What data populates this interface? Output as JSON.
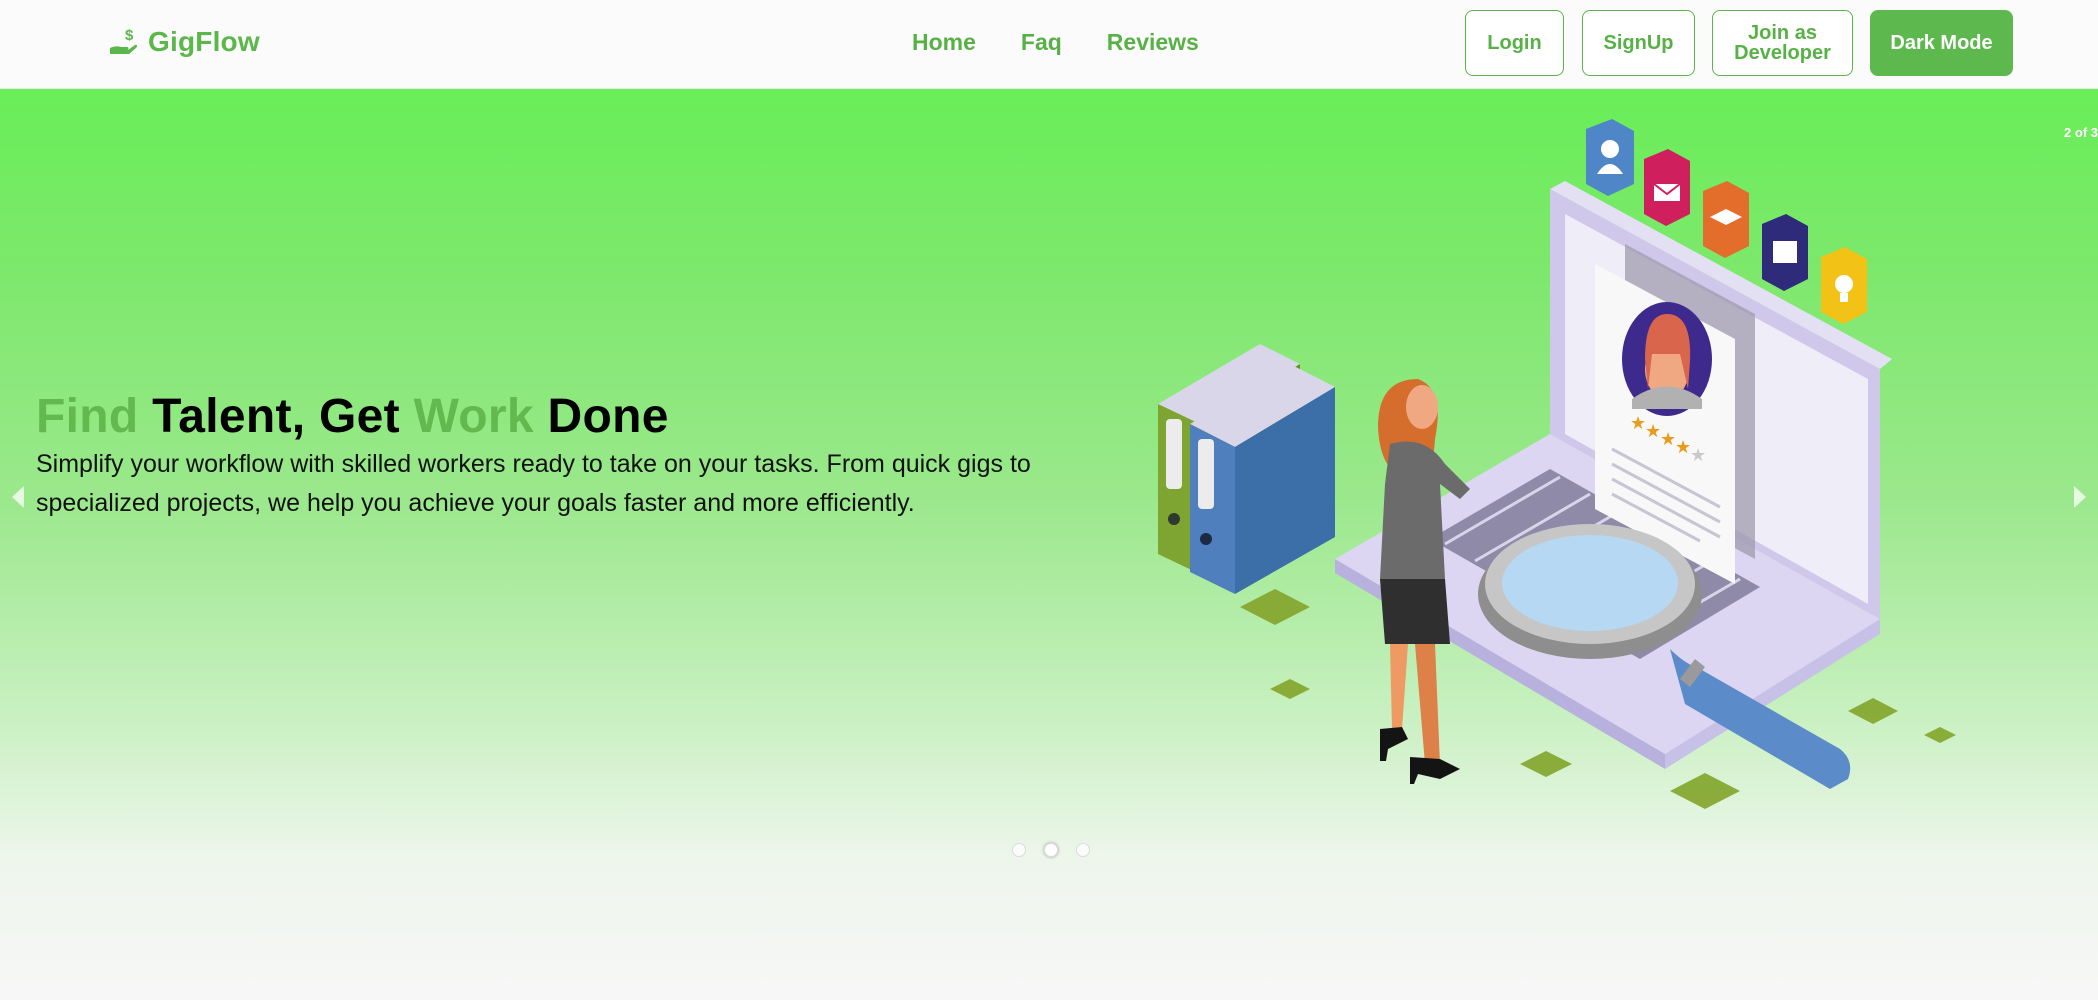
{
  "brand": {
    "name": "GigFlow",
    "icon": "hand-dollar-icon",
    "color": "#5cb74a"
  },
  "nav": {
    "links": [
      {
        "label": "Home"
      },
      {
        "label": "Faq"
      },
      {
        "label": "Reviews"
      }
    ],
    "buttons": {
      "login": "Login",
      "signup": "SignUp",
      "developer": "Join as Developer",
      "dark_mode": "Dark Mode"
    }
  },
  "hero": {
    "slide_counter": "2 of 3",
    "current_slide": 2,
    "total_slides": 3,
    "title": {
      "w1": "Find",
      "w2": "Talent, Get",
      "w3": "Work",
      "w4": "Done"
    },
    "description": "Simplify your workflow with skilled workers ready to take on your tasks. From quick gigs to specialized projects, we help you achieve your goals faster and more efficiently.",
    "illustration": "hiring-illustration",
    "prev_icon": "chevron-left-icon",
    "next_icon": "chevron-right-icon"
  },
  "colors": {
    "accent": "#5cb74a",
    "hero_top": "#69ee58",
    "hero_bottom": "#f7f7f7"
  }
}
